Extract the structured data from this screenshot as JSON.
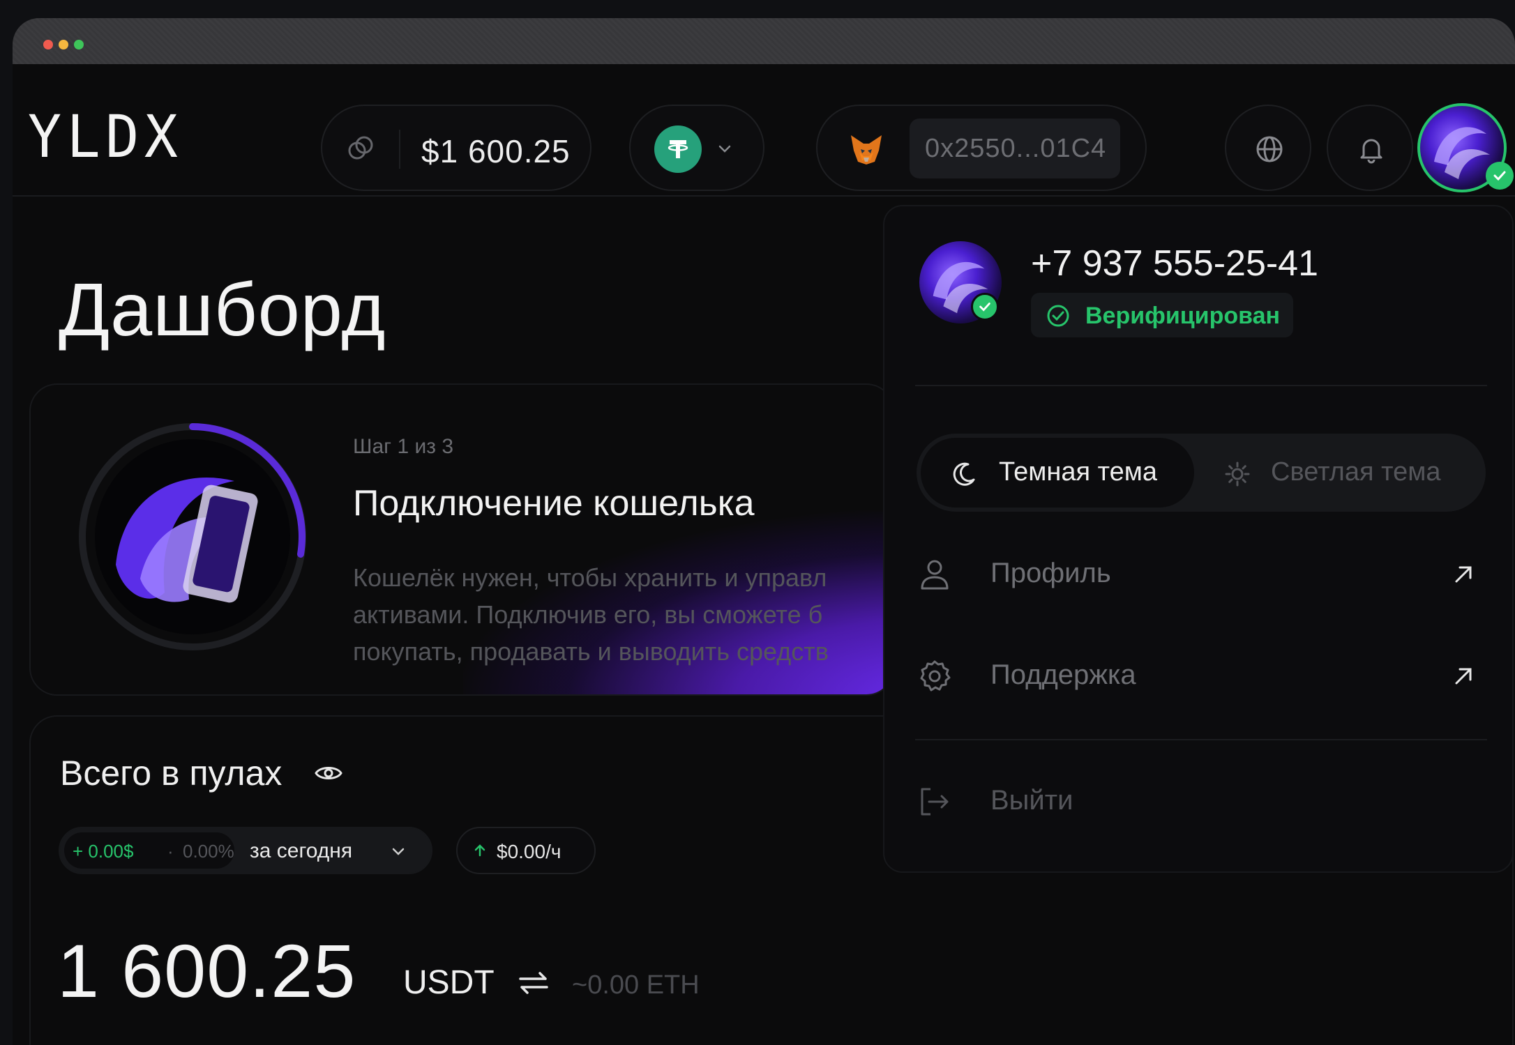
{
  "header": {
    "logo": "YLDX",
    "balance": "$1 600.25",
    "wallet_address": "0x2550...01C4"
  },
  "main": {
    "title": "Дашборд",
    "onboarding": {
      "step": "Шаг 1 из 3",
      "title": "Подключение кошелька",
      "description_lines": [
        "Кошелёк нужен, чтобы хранить и управл",
        "активами. Подключив его, вы сможете б",
        "покупать, продавать и выводить средств"
      ]
    },
    "pools": {
      "title": "Всего в пулах",
      "change_usd": "+ 0.00$",
      "change_sep": "·",
      "change_pct": "0.00%",
      "period": "за сегодня",
      "rate": "$0.00/ч",
      "total_value": "1 600.25",
      "total_unit": "USDT",
      "eth_value": "~0.00 ETH"
    }
  },
  "dropdown": {
    "phone": "+7 937 555-25-41",
    "verified": "Верифицирован",
    "theme_dark": "Темная тема",
    "theme_light": "Светлая тема",
    "menu": [
      {
        "label": "Профиль",
        "icon": "user-icon"
      },
      {
        "label": "Поддержка",
        "icon": "gear-icon"
      }
    ],
    "logout": "Выйти"
  },
  "colors": {
    "accent_green": "#27c46b",
    "tether_green": "#26a17b",
    "purple": "#6a2cf0"
  }
}
